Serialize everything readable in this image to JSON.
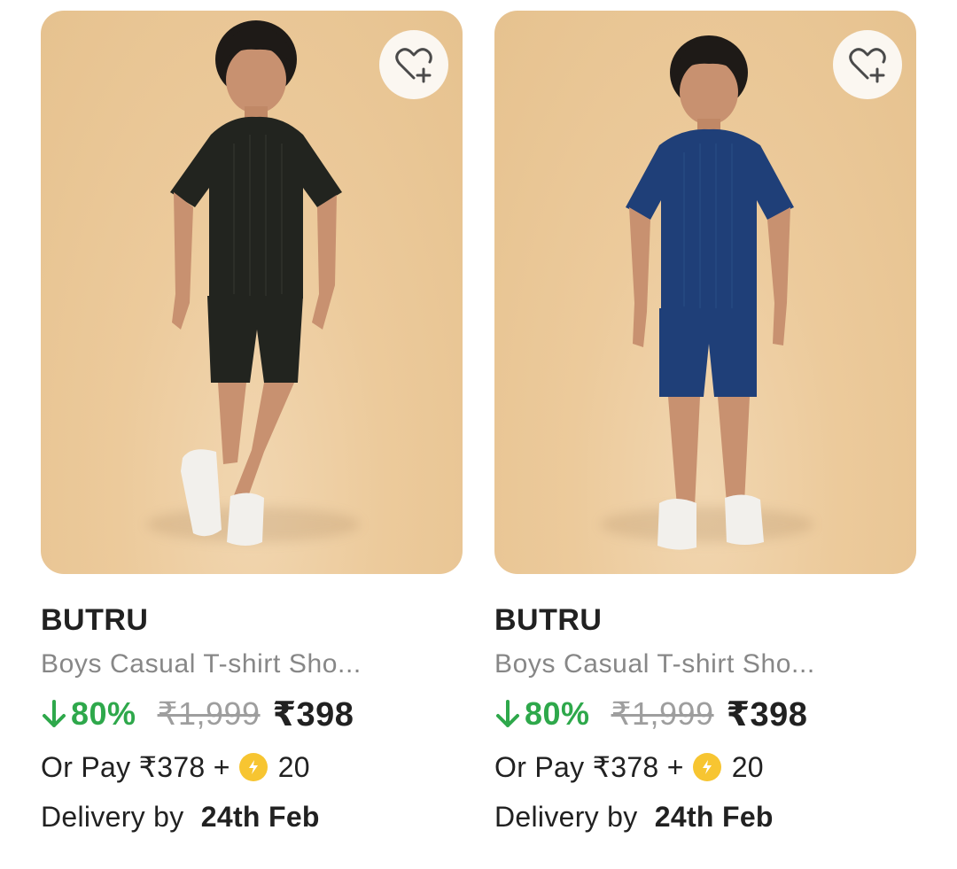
{
  "products": [
    {
      "brand": "BUTRU",
      "title": "Boys Casual T-shirt Sho...",
      "discount": "80%",
      "mrp": "₹1,999",
      "price": "₹398",
      "pay_prefix": "Or Pay ₹378 +",
      "coins": "20",
      "delivery_prefix": "Delivery by",
      "delivery_date": "24th Feb",
      "outfit_color": "#22241f",
      "image_bg": "#e9c795"
    },
    {
      "brand": "BUTRU",
      "title": "Boys Casual T-shirt Sho...",
      "discount": "80%",
      "mrp": "₹1,999",
      "price": "₹398",
      "pay_prefix": "Or Pay ₹378 +",
      "coins": "20",
      "delivery_prefix": "Delivery by",
      "delivery_date": "24th Feb",
      "outfit_color": "#1f3f78",
      "image_bg": "#e9c795"
    }
  ],
  "icons": {
    "wishlist": "heart-plus-icon",
    "discount_arrow": "arrow-down-icon",
    "coin": "supercoin-icon"
  },
  "colors": {
    "discount_green": "#2ea84b",
    "muted_text": "#878787",
    "coin_yellow": "#f7c531"
  }
}
